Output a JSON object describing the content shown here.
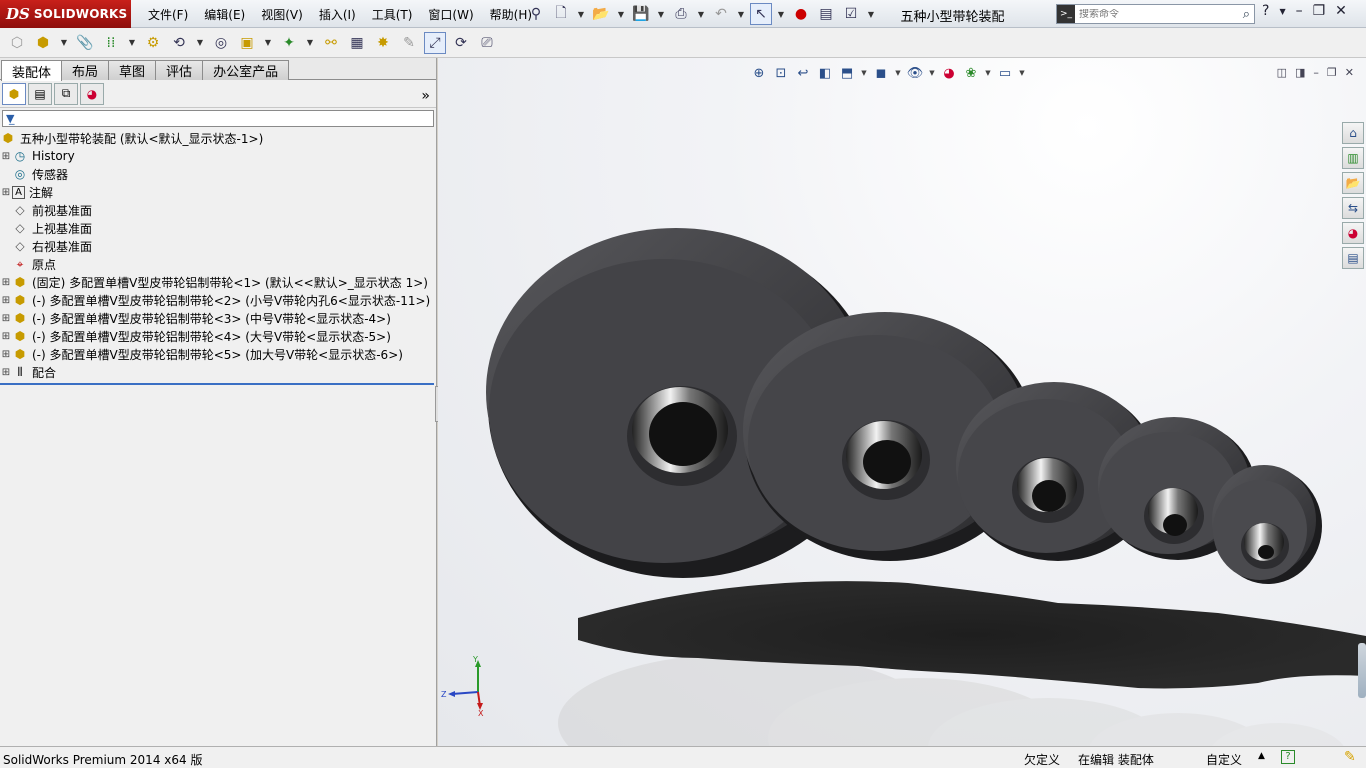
{
  "app": {
    "logo_ds": "DS",
    "logo_name": "SOLIDWORKS",
    "document_title": "五种小型带轮装配",
    "search_placeholder": "搜索命令"
  },
  "menu": [
    "文件(F)",
    "编辑(E)",
    "视图(V)",
    "插入(I)",
    "工具(T)",
    "窗口(W)",
    "帮助(H)"
  ],
  "command_manager_tabs": [
    {
      "label": "装配体",
      "active": true
    },
    {
      "label": "布局",
      "active": false
    },
    {
      "label": "草图",
      "active": false
    },
    {
      "label": "评估",
      "active": false
    },
    {
      "label": "办公室产品",
      "active": false
    }
  ],
  "feature_tree": {
    "root": "五种小型带轮装配  (默认<默认_显示状态-1>)",
    "items": [
      {
        "label": "History",
        "icon": "history-icon",
        "expandable": true
      },
      {
        "label": "传感器",
        "icon": "sensor-icon",
        "expandable": false
      },
      {
        "label": "注解",
        "icon": "annotation-icon",
        "expandable": true
      },
      {
        "label": "前视基准面",
        "icon": "plane-icon",
        "expandable": false
      },
      {
        "label": "上视基准面",
        "icon": "plane-icon",
        "expandable": false
      },
      {
        "label": "右视基准面",
        "icon": "plane-icon",
        "expandable": false
      },
      {
        "label": "原点",
        "icon": "origin-icon",
        "expandable": false
      },
      {
        "label": "(固定) 多配置单槽V型皮带轮铝制带轮<1> (默认<<默认>_显示状态 1>)",
        "icon": "part-icon",
        "expandable": true
      },
      {
        "label": "(-) 多配置单槽V型皮带轮铝制带轮<2> (小号V带轮内孔6<显示状态-11>)",
        "icon": "part-icon",
        "expandable": true
      },
      {
        "label": "(-) 多配置单槽V型皮带轮铝制带轮<3> (中号V带轮<显示状态-4>)",
        "icon": "part-icon",
        "expandable": true
      },
      {
        "label": "(-) 多配置单槽V型皮带轮铝制带轮<4> (大号V带轮<显示状态-5>)",
        "icon": "part-icon",
        "expandable": true
      },
      {
        "label": "(-) 多配置单槽V型皮带轮铝制带轮<5> (加大号V带轮<显示状态-6>)",
        "icon": "part-icon",
        "expandable": true
      },
      {
        "label": "配合",
        "icon": "mates-icon",
        "expandable": true
      }
    ]
  },
  "triad": {
    "x": "X",
    "y": "Y",
    "z": "Z"
  },
  "status_bar": {
    "product": "SolidWorks Premium 2014 x64 版",
    "definition": "欠定义",
    "editing": "在编辑 装配体",
    "units": "自定义"
  },
  "colors": {
    "logo_red": "#b5171a",
    "pulley": "#3b3b3f",
    "selection_blue": "#3a6fc4"
  }
}
